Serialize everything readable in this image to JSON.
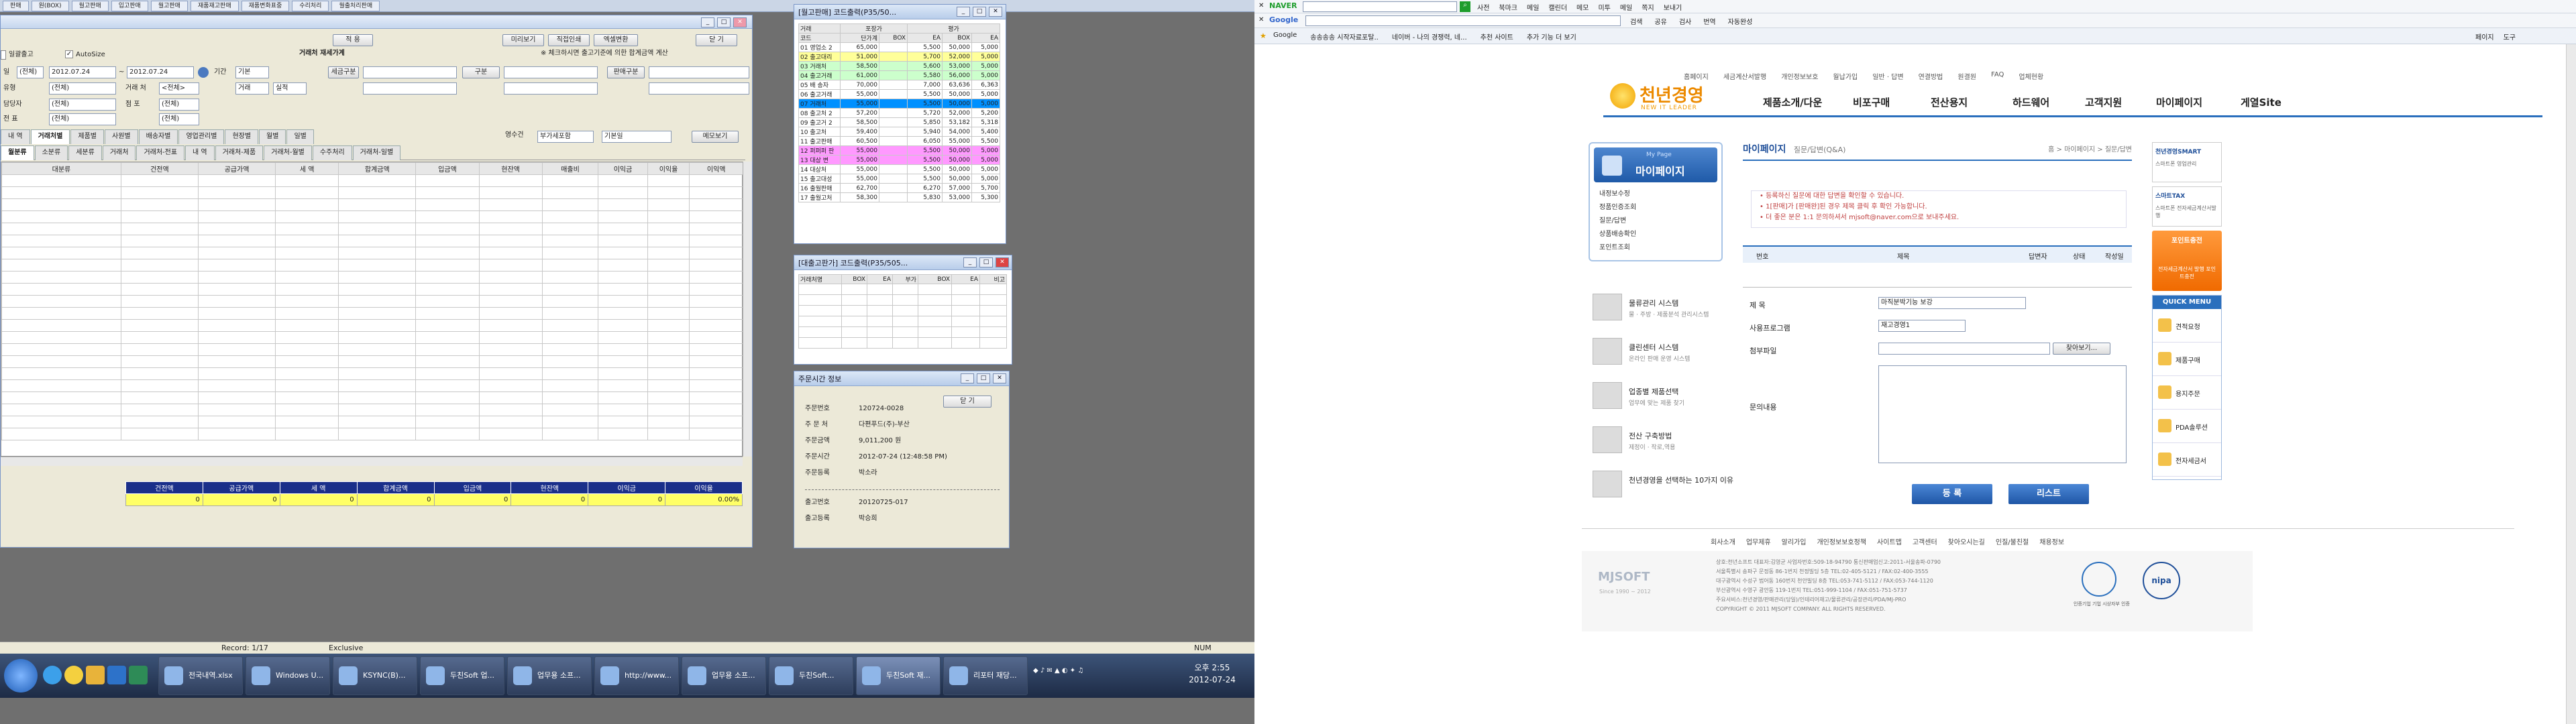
{
  "top_strip": [
    "판매",
    "원(BOX)",
    "월고판매",
    "입고판매",
    "월고판매",
    "재품재고판매",
    "재품변화표중",
    "수리처리",
    "월출처리판매"
  ],
  "main": {
    "title_btn": "적 용",
    "tax_label": "거래처 재세가계",
    "btn_print": "미리보기",
    "btn_direct": "직접인쇄",
    "btn_excel": "엑셀변환",
    "btn_close": "닫 기",
    "notice": "※ 체크하시면 출고기준에 의한 합계금액 계산",
    "chk_label": "일괄출고",
    "autosize": "AutoSize",
    "date_from": "2012.07.24",
    "date_to": "2012.07.24",
    "labels": {
      "date": "일",
      "period": "기간",
      "type": "유형",
      "tax": "세금구분",
      "gubun": "구분",
      "sales": "판매구분",
      "fee": "거래 처",
      "emp": "담당자",
      "jum": "점 포",
      "person": "전 표",
      "weight": "금 액"
    },
    "sel": {
      "all1": "(전체)",
      "all2": "(전체)",
      "all3": "(전체)",
      "etc": "<전체>",
      "basis": "기본",
      "type2": "거래",
      "sum": "실적"
    },
    "tabs": [
      "내 역",
      "거래처별",
      "제품별",
      "사원별",
      "배송자별",
      "영업관리별",
      "현장별",
      "월별",
      "일별"
    ],
    "tab_sel": "거래처별",
    "right_labels": {
      "cols": "영수건",
      "sort": "부가세포함",
      "base": "기본일",
      "btn_memo": "메모보기"
    },
    "sub_tabs": [
      "월분류",
      "소분류",
      "세분류",
      "거래처",
      "거래처-전표",
      "내 역",
      "거래처-제품",
      "거래처-월별",
      "수주처리",
      "거래처-일별"
    ],
    "cols": [
      "대분류",
      "건전액",
      "공급가액",
      "세 액",
      "합계금액",
      "입금액",
      "현잔액",
      "매출비",
      "이익금",
      "이익율",
      "이익액"
    ],
    "foot_cols": [
      "건전액",
      "공급가액",
      "세 액",
      "합계금액",
      "입금액",
      "현잔액",
      "이익금",
      "이익율"
    ],
    "foot_vals": [
      "0",
      "0",
      "0",
      "0",
      "0",
      "0",
      "0",
      "0.00%"
    ],
    "status": [
      "Record: 1/17",
      "Exclusive",
      "NUM"
    ]
  },
  "inv": {
    "title": "[월고판매] 코드출력(P35/50...",
    "head": [
      "거래",
      "포장가",
      "",
      "평가"
    ],
    "sub": [
      "코드",
      "단가계",
      "BOX",
      "EA",
      "BOX",
      "EA"
    ],
    "rows": [
      [
        "01 영업소 2",
        "65,000",
        "5,500",
        "50,000",
        "5,000"
      ],
      [
        "02 출고대리",
        "51,000",
        "5,700",
        "52,000",
        "5,000"
      ],
      [
        "03 거래처",
        "58,500",
        "5,600",
        "53,000",
        "5,000"
      ],
      [
        "04 출고거래",
        "61,000",
        "5,580",
        "56,000",
        "5,000"
      ],
      [
        "05 배 송자",
        "70,000",
        "7,000",
        "63,636",
        "6,363"
      ],
      [
        "06 출고거래",
        "55,000",
        "5,500",
        "50,000",
        "5,000"
      ],
      [
        "07 거래처",
        "55,000",
        "5,500",
        "50,000",
        "5,000"
      ],
      [
        "08 출고처 2",
        "57,200",
        "5,720",
        "52,000",
        "5,200"
      ],
      [
        "09 출고거 2",
        "58,500",
        "5,850",
        "53,182",
        "5,318"
      ],
      [
        "10 출고처",
        "59,400",
        "5,940",
        "54,000",
        "5,400"
      ],
      [
        "11 출고판매",
        "60,500",
        "6,050",
        "55,000",
        "5,500"
      ],
      [
        "12 퍼퍼퍼 판",
        "55,000",
        "5,500",
        "50,000",
        "5,000"
      ],
      [
        "13 대상 변",
        "55,000",
        "5,500",
        "50,000",
        "5,000"
      ],
      [
        "14 대상처",
        "55,000",
        "5,500",
        "50,000",
        "5,000"
      ],
      [
        "15 출고대성",
        "55,000",
        "5,500",
        "50,000",
        "5,000"
      ],
      [
        "16 출월판매",
        "62,700",
        "6,270",
        "57,000",
        "5,700"
      ],
      [
        "17 출월고처",
        "58,300",
        "5,830",
        "53,000",
        "5,300"
      ]
    ],
    "row_colors": [
      "#ffffff",
      "#ffff99",
      "#ccffcc",
      "#ccffcc",
      "#ffffff",
      "#ffffff",
      "#0090ff",
      "#ffffff",
      "#ffffff",
      "#ffffff",
      "#ffffff",
      "#ff99ff",
      "#ff99ff",
      "#ffffff",
      "#ffffff",
      "#ffffff",
      "#ffffff"
    ]
  },
  "inv2": {
    "title": "[대출고판가] 코드출력(P35/505...",
    "head": [
      "거래처명",
      "BOX",
      "EA",
      "부가",
      "BOX",
      "EA",
      "비고"
    ]
  },
  "order": {
    "title": "주문시간 정보",
    "close": "닫 기",
    "items": [
      [
        "주문번호",
        "120724-0028"
      ],
      [
        "주 문 처",
        "다편푸드(주)-부산"
      ],
      [
        "주문금액",
        "9,011,200 원"
      ],
      [
        "주문시간",
        "2012-07-24 (12:48:58 PM)"
      ],
      [
        "주문등록",
        "박소라"
      ]
    ],
    "items2": [
      [
        "출고번호",
        "20120725-017"
      ],
      [
        "출고등록",
        "박승희"
      ]
    ]
  },
  "taskbar": {
    "items": [
      "전국내역.xlsx",
      "Windows U...",
      "KSYNC(B)...",
      "두친Soft 업...",
      "업무용 소프...",
      "http://www...",
      "업무용 소프...",
      "두친Soft...",
      "두친Soft 재...",
      "리포터 재당..."
    ],
    "time": "오후 2:55",
    "date": "2012-07-24"
  },
  "browser": {
    "naver": "NAVER",
    "naver_items": [
      "사전",
      "북마크",
      "메일",
      "캘린더",
      "메모",
      "미투",
      "메일",
      "쪽지",
      "보내기"
    ],
    "google": "Google",
    "google_items": [
      "검색",
      "공유",
      "검사",
      "번역",
      "자동완성"
    ],
    "favs": [
      "Google",
      "송송송송 시작자료포탈..",
      "네이버 - 나의 경쟁력, 네...",
      "추천 사이트",
      "추가 기능 더 보기"
    ],
    "right_tools": [
      "페이지",
      "도구"
    ],
    "topnav": [
      "홈페이지",
      "세금계산서발행",
      "개인정보보호",
      "월납가입",
      "일반 · 답변",
      "연결방법",
      "원결원",
      "FAQ",
      "업체현황"
    ],
    "logo": "천년경영",
    "logo_sub": "NEW IT LEADER",
    "nav": [
      "제품소개/다운",
      "비포구매",
      "전산용지",
      "하드웨어",
      "고객지원",
      "마이페이지",
      "게열Site"
    ],
    "mypage_small": "My Page",
    "mypage": "마이페이지",
    "side": [
      "내정보수정",
      "정품인증조회",
      "질문/답변",
      "상품배송확인",
      "포인트조회"
    ],
    "services": [
      [
        "물류관리 시스템",
        "물 · 주방 · 제품분석 관리시스템"
      ],
      [
        "클린센터 시스템",
        "온라인 판매 운영 시스템"
      ],
      [
        "업종별 제품선택",
        "업무에 맞는 제품 찾기"
      ],
      [
        "전산 구축방법",
        "제정이 · 작로,역용"
      ],
      [
        "천년경영을 선택하는 10가지 이유",
        ""
      ]
    ],
    "page_title": "마이페이지",
    "page_sub": "질문/답변(Q&A)",
    "crumb": "홈 > 마이페이지 > 질문/답변",
    "notes": [
      "• 등록하신 질문에 대한 답변을 확인할 수 있습니다.",
      "• 1[판매]가 [판매완]된 경우 제목 클릭 후 확인 가능합니다.",
      "• 더 좋은 분은 1:1 문의하셔서 mjsoft@naver.com으로 보내주세요."
    ],
    "th": [
      "번호",
      "제목",
      "답변자",
      "상태",
      "작성일"
    ],
    "form": {
      "subject_label": "제 목",
      "subject": "마직분박기능 보강",
      "prog_label": "사용프로그램",
      "prog": "재고경영1",
      "file_label": "첨부파일",
      "file_btn": "찾아보기...",
      "content_label": "문의내용"
    },
    "btn_reg": "등 록",
    "btn_list": "리스트",
    "right": [
      "천년경영SMART",
      "스마트폰 영업관리",
      "스마트TAX",
      "스마트폰 전자세금계산서발행",
      "포인트충전",
      "전자세금계산서 발행 포인트충전"
    ],
    "quick_title": "QUICK MENU",
    "quick": [
      "견적요청",
      "제품구매",
      "용지주문",
      "PDA솔루션",
      "전자세금서"
    ],
    "footlinks": [
      "회사소개",
      "업무제휴",
      "알리가입",
      "개인정보보호정책",
      "사이트맵",
      "고객센터",
      "찾아오시는길",
      "인질/불친절",
      "채용정보"
    ],
    "foot_logo": "MJSOFT",
    "foot_logo_sub": "Since 1990 ~ 2012",
    "foot_lines": [
      "상호:천년소프트  대표자:김영균 사업자번호:509-18-94790 통신판매업신고:2011-서울송파-0790",
      "서울특별시 송파구 문정동 86-1번지 천정빌딩 5층 TEL:02-405-5121 / FAX:02-400-3555",
      "대구광역시 수성구 범어동 160번지 천안빌딩 8층 TEL:053-741-5112 / FAX:053-744-1120",
      "부산광역시 수영구 광안동 119-1번지 TEL:051-999-1104 / FAX:051-751-5737",
      "주요서비스:천년경영/판매관리(당일)/인테리어재고/물류관리/공장관리/PDA/MJ-PRO",
      "COPYRIGHT © 2011 MJSOFT COMPANY. ALL RIGHTS RESERVED."
    ],
    "cert1": "인증기업 기업 시상자부 인증",
    "cert2": "nipa"
  }
}
